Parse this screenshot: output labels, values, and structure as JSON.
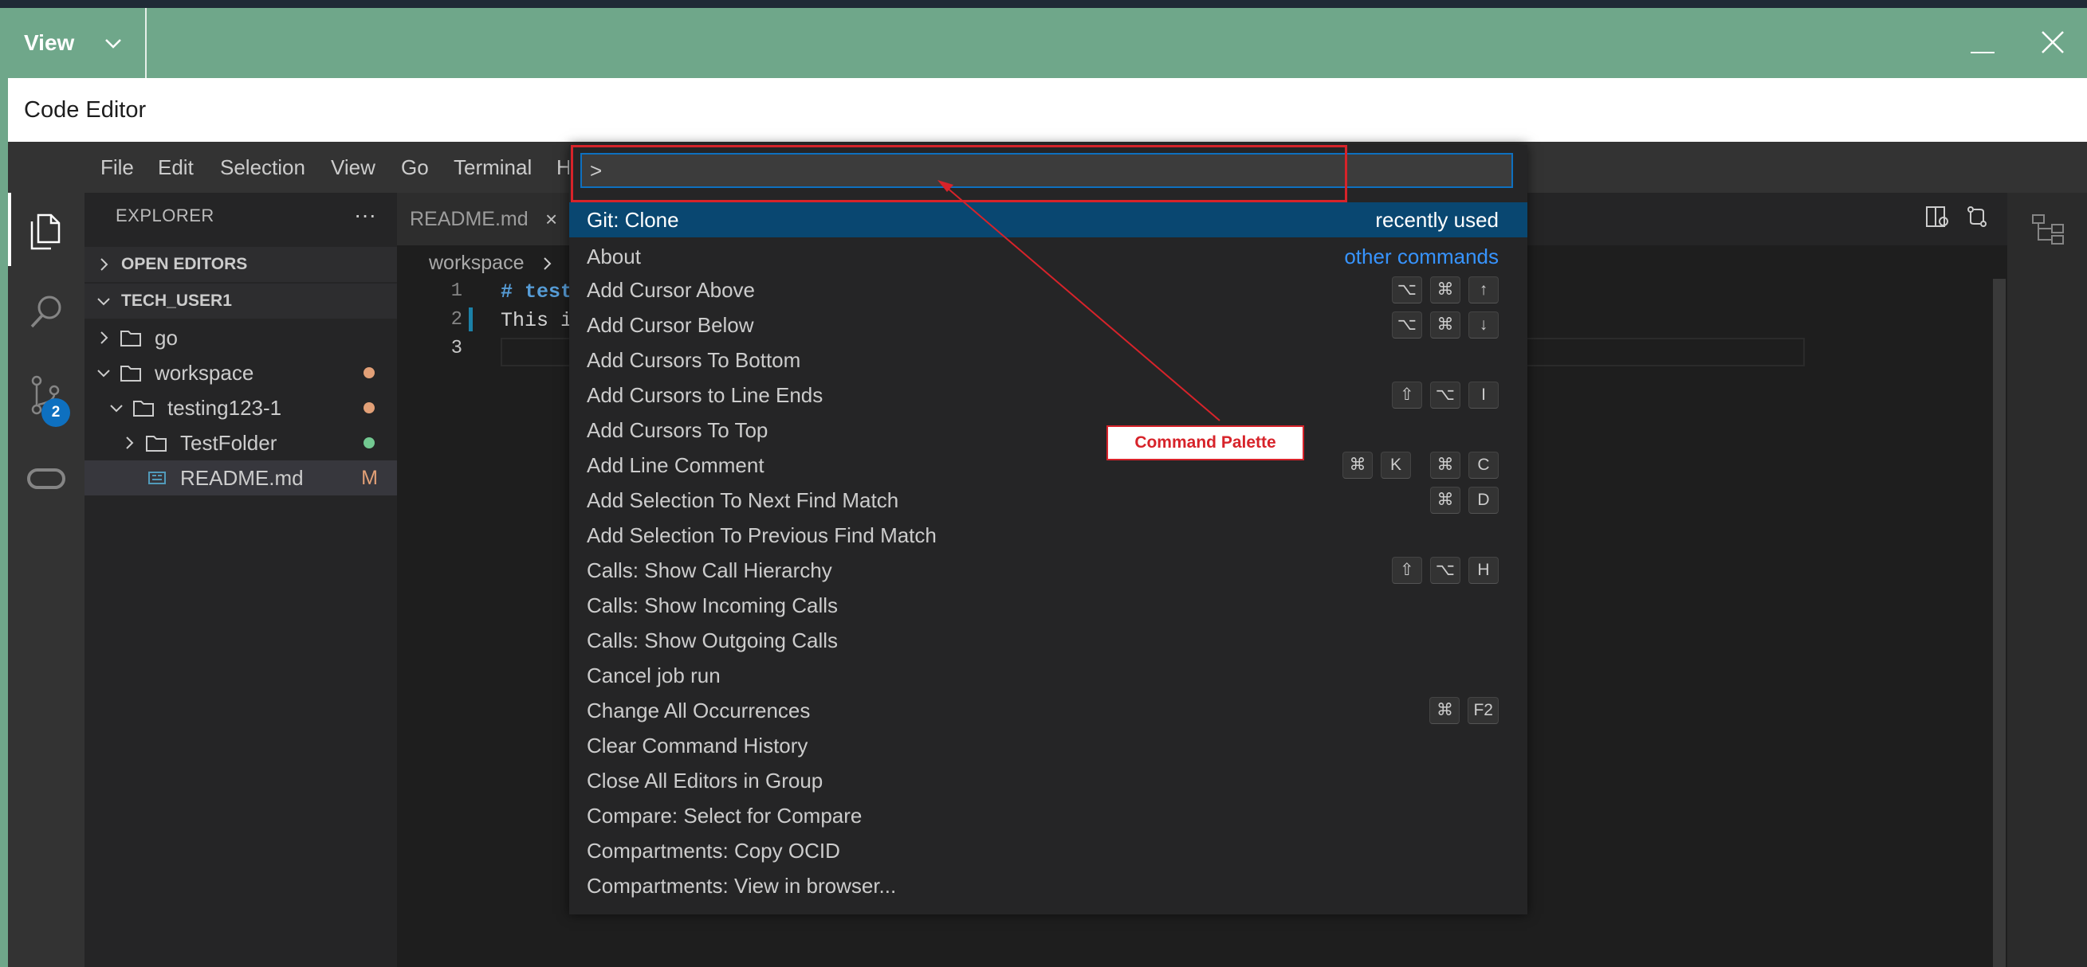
{
  "window": {
    "view_button": "View",
    "app_title": "Code Editor"
  },
  "menubar": [
    "File",
    "Edit",
    "Selection",
    "View",
    "Go",
    "Terminal",
    "H"
  ],
  "activity_bar": {
    "scm_badge": "2",
    "icons": [
      "files-icon",
      "search-icon",
      "source-control-icon",
      "oracle-cloud-icon"
    ]
  },
  "sidebar": {
    "title": "EXPLORER",
    "more": "···",
    "sections": [
      "OPEN EDITORS",
      "TECH_USER1"
    ],
    "tree": [
      {
        "label": "go",
        "marker": ""
      },
      {
        "label": "workspace",
        "marker": "dot"
      },
      {
        "label": "testing123-1",
        "marker": "dot"
      },
      {
        "label": "TestFolder",
        "marker": "dot"
      },
      {
        "label": "README.md",
        "marker": "M"
      }
    ],
    "modified_marker": "M"
  },
  "editor": {
    "tab_label": "README.md",
    "tab_close": "×",
    "breadcrumb": "workspace",
    "line_numbers": [
      "1",
      "2",
      "3"
    ],
    "lines": [
      "# test",
      "This i",
      ""
    ]
  },
  "palette": {
    "input_value": ">",
    "items": [
      {
        "label": "Git: Clone",
        "right": "recently used"
      },
      {
        "label": "About",
        "right": "other commands"
      },
      {
        "label": "Add Cursor Above",
        "keys": [
          "⌥",
          "⌘",
          "↑"
        ]
      },
      {
        "label": "Add Cursor Below",
        "keys": [
          "⌥",
          "⌘",
          "↓"
        ]
      },
      {
        "label": "Add Cursors To Bottom"
      },
      {
        "label": "Add Cursors to Line Ends",
        "keys": [
          "⇧",
          "⌥",
          "I"
        ]
      },
      {
        "label": "Add Cursors To Top"
      },
      {
        "label": "Add Line Comment",
        "keys": [
          "⌘",
          "K",
          "⌘",
          "C"
        ]
      },
      {
        "label": "Add Selection To Next Find Match",
        "keys": [
          "⌘",
          "D"
        ]
      },
      {
        "label": "Add Selection To Previous Find Match"
      },
      {
        "label": "Calls: Show Call Hierarchy",
        "keys": [
          "⇧",
          "⌥",
          "H"
        ]
      },
      {
        "label": "Calls: Show Incoming Calls"
      },
      {
        "label": "Calls: Show Outgoing Calls"
      },
      {
        "label": "Cancel job run"
      },
      {
        "label": "Change All Occurrences",
        "keys": [
          "⌘",
          "F2"
        ]
      },
      {
        "label": "Clear Command History"
      },
      {
        "label": "Close All Editors in Group"
      },
      {
        "label": "Compare: Select for Compare"
      },
      {
        "label": "Compartments: Copy OCID"
      },
      {
        "label": "Compartments: View in browser..."
      }
    ]
  },
  "annotation": {
    "label": "Command Palette",
    "color": "#d7232a"
  },
  "colors": {
    "titlebar": "#6fa78a",
    "selection": "#094771",
    "accent": "#0e70c0",
    "modified": "#e2a077",
    "untracked": "#73c991"
  }
}
